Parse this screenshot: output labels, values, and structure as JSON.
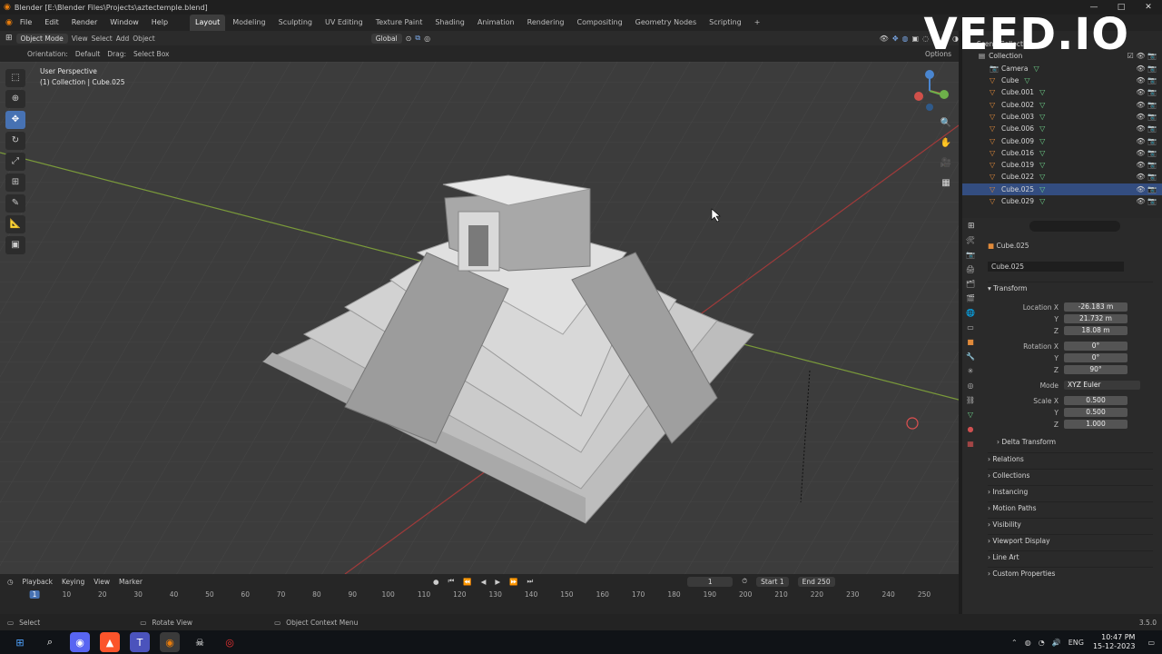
{
  "titlebar": {
    "title": "Blender [E:\\Blender Files\\Projects\\aztectemple.blend]",
    "min": "—",
    "max": "□",
    "close": "✕"
  },
  "menu": [
    "File",
    "Edit",
    "Render",
    "Window",
    "Help"
  ],
  "workspaces": [
    "Layout",
    "Modeling",
    "Sculpting",
    "UV Editing",
    "Texture Paint",
    "Shading",
    "Animation",
    "Rendering",
    "Compositing",
    "Geometry Nodes",
    "Scripting"
  ],
  "active_workspace": "Layout",
  "header": {
    "mode": "Object Mode",
    "view": "View",
    "select": "Select",
    "add": "Add",
    "object": "Object",
    "transform": "Global",
    "options": "Options"
  },
  "header2": {
    "orientation_label": "Orientation:",
    "orientation": "Default",
    "drag_label": "Drag:",
    "drag": "Select Box"
  },
  "viewport": {
    "perspective": "User Perspective",
    "collection_path": "(1) Collection | Cube.025"
  },
  "outliner": {
    "scene_collection": "Scene Collection",
    "collection": "Collection",
    "items": [
      "Camera",
      "Cube",
      "Cube.001",
      "Cube.002",
      "Cube.003",
      "Cube.006",
      "Cube.009",
      "Cube.016",
      "Cube.019",
      "Cube.022",
      "Cube.025",
      "Cube.029"
    ]
  },
  "properties": {
    "object_name": "Cube.025",
    "data_name": "Cube.025",
    "transform": "Transform",
    "location_label": "Location X",
    "loc": [
      "-26.183 m",
      "21.732 m",
      "18.08 m"
    ],
    "rotation_label": "Rotation X",
    "rot": [
      "0°",
      "0°",
      "90°"
    ],
    "mode_label": "Mode",
    "mode": "XYZ Euler",
    "scale_label": "Scale X",
    "scale": [
      "0.500",
      "0.500",
      "1.000"
    ],
    "y": "Y",
    "z": "Z",
    "delta": "Delta Transform",
    "sections": [
      "Relations",
      "Collections",
      "Instancing",
      "Motion Paths",
      "Visibility",
      "Viewport Display",
      "Line Art",
      "Custom Properties"
    ]
  },
  "timeline": {
    "playback": "Playback",
    "keying": "Keying",
    "view": "View",
    "marker": "Marker",
    "current": "1",
    "start_label": "Start",
    "start": "1",
    "end_label": "End",
    "end": "250",
    "ticks": [
      "1",
      "10",
      "20",
      "30",
      "40",
      "50",
      "60",
      "70",
      "80",
      "90",
      "100",
      "110",
      "120",
      "130",
      "140",
      "150",
      "160",
      "170",
      "180",
      "190",
      "200",
      "210",
      "220",
      "230",
      "240",
      "250"
    ]
  },
  "status": {
    "select": "Select",
    "rotate": "Rotate View",
    "context": "Object Context Menu",
    "version": "3.5.0"
  },
  "taskbar": {
    "lang": "ENG",
    "time": "10:47 PM",
    "date": "15-12-2023"
  },
  "watermark": "VEED.IO",
  "colors": {
    "accent": "#4772b3",
    "orange": "#e08a3a",
    "green": "#6fd28c"
  }
}
